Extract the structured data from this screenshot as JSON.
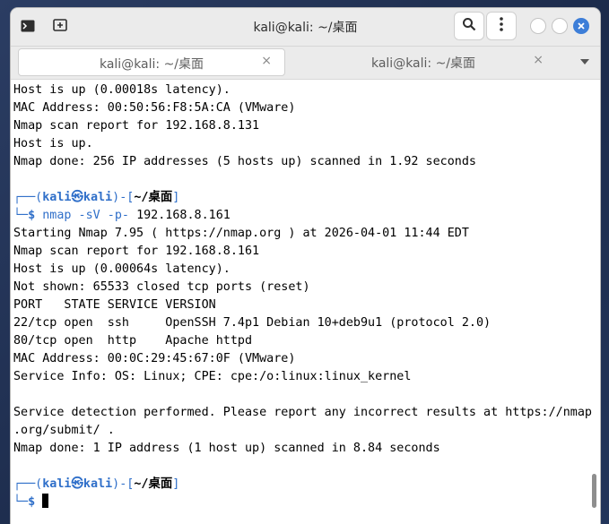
{
  "window": {
    "title": "kali@kali: ~/桌面"
  },
  "tabs": [
    {
      "label": "kali@kali: ~/桌面",
      "close": "×",
      "active": true
    },
    {
      "label": "kali@kali: ~/桌面",
      "close": "×",
      "active": false
    }
  ],
  "colors": {
    "prompt": "#2f6fc9",
    "headerbar": "#ebebeb",
    "close_button": "#3d7ed8"
  },
  "icons": [
    "terminal-icon",
    "new-tab-icon",
    "search-icon",
    "kebab-menu-icon",
    "minimize-icon",
    "maximize-icon",
    "close-icon",
    "tabs-dropdown-icon"
  ],
  "terminal": {
    "lines_before": [
      "Host is up (0.00018s latency).",
      "MAC Address: 00:50:56:F8:5A:CA (VMware)",
      "Nmap scan report for 192.168.8.131",
      "Host is up.",
      "Nmap done: 256 IP addresses (5 hosts up) scanned in 1.92 seconds"
    ],
    "prompt1": {
      "open": "┌──(",
      "user": "kali㉿kali",
      "mid": ")-[",
      "path": "~/桌面",
      "close": "]",
      "arrow": "└─",
      "dollar": "$",
      "command": " nmap -sV -p- ",
      "arg": "192.168.8.161"
    },
    "output": [
      "Starting Nmap 7.95 ( https://nmap.org ) at 2026-04-01 11:44 EDT",
      "Nmap scan report for 192.168.8.161",
      "Host is up (0.00064s latency).",
      "Not shown: 65533 closed tcp ports (reset)",
      "PORT   STATE SERVICE VERSION",
      "22/tcp open  ssh     OpenSSH 7.4p1 Debian 10+deb9u1 (protocol 2.0)",
      "80/tcp open  http    Apache httpd",
      "MAC Address: 00:0C:29:45:67:0F (VMware)",
      "Service Info: OS: Linux; CPE: cpe:/o:linux:linux_kernel",
      "",
      "Service detection performed. Please report any incorrect results at https://nmap",
      ".org/submit/ .",
      "Nmap done: 1 IP address (1 host up) scanned in 8.84 seconds"
    ],
    "prompt2": {
      "open": "┌──(",
      "user": "kali㉿kali",
      "mid": ")-[",
      "path": "~/桌面",
      "close": "]",
      "arrow": "└─",
      "dollar": "$"
    }
  }
}
